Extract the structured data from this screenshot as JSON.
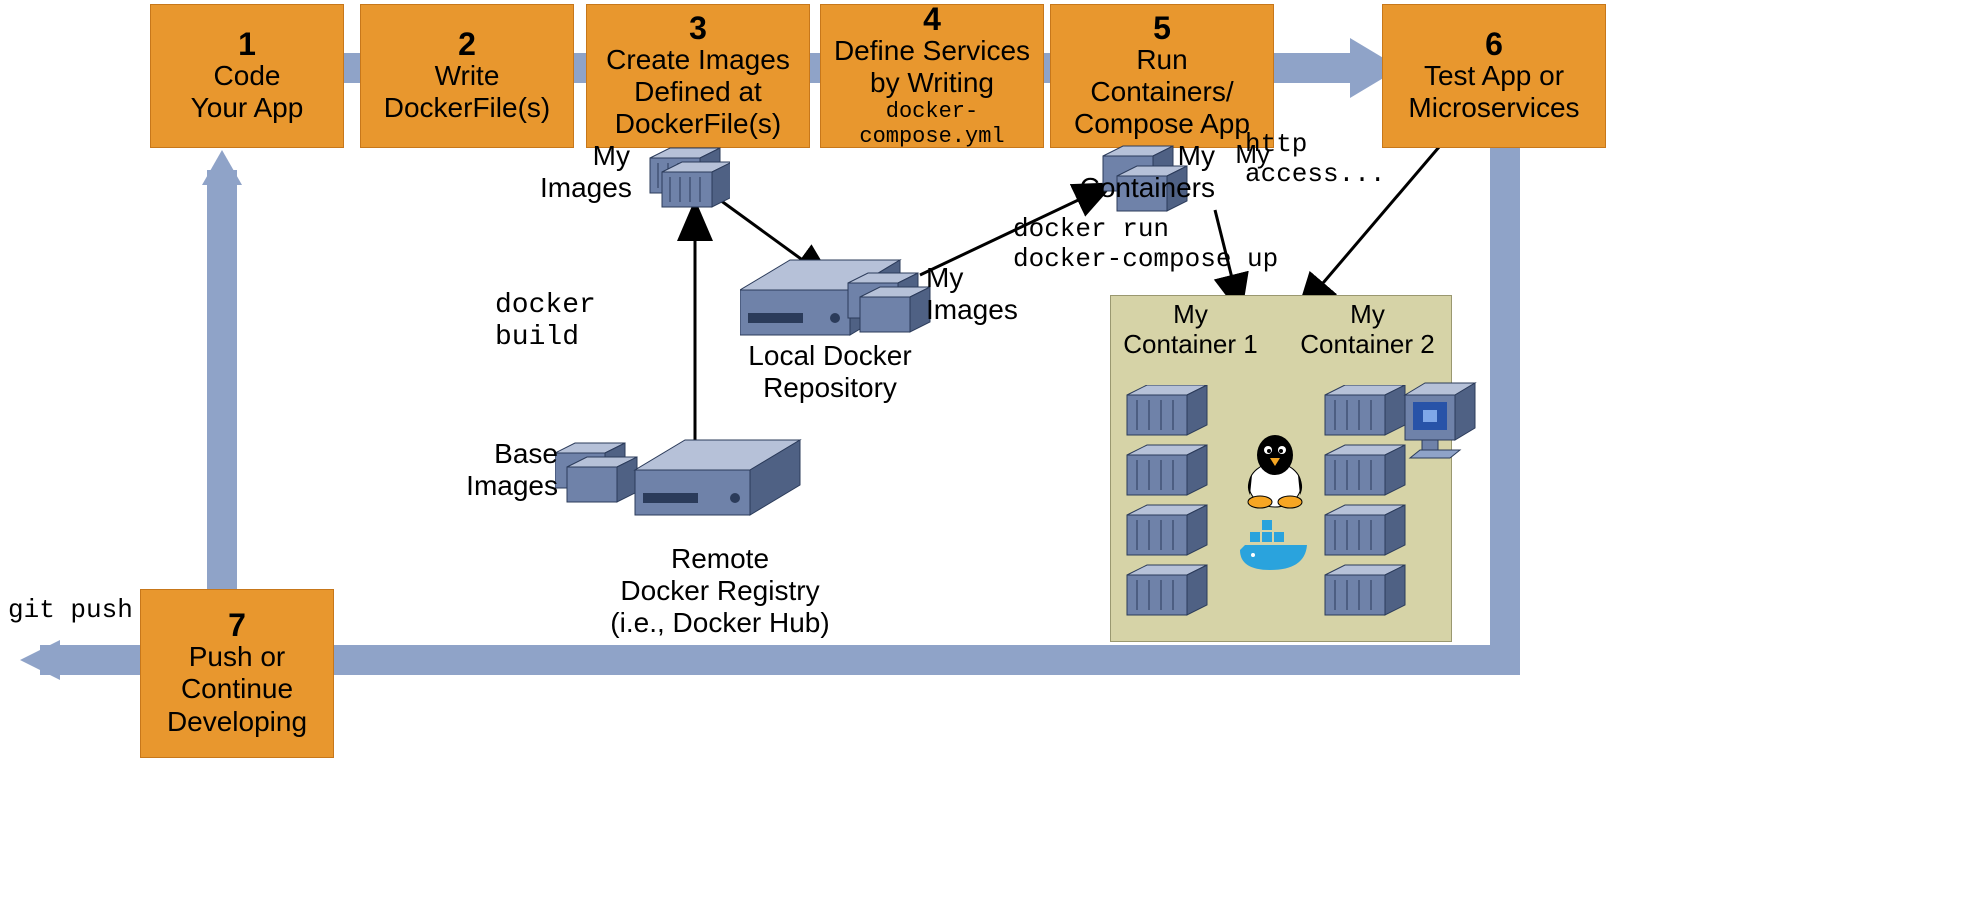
{
  "steps": [
    {
      "n": "1",
      "l1": "Code",
      "l2": "Your App"
    },
    {
      "n": "2",
      "l1": "Write",
      "l2": "DockerFile(s)"
    },
    {
      "n": "3",
      "l1": "Create Images",
      "l2": "Defined at",
      "l3": "DockerFile(s)"
    },
    {
      "n": "4",
      "l1": "Define Services",
      "l2": "by Writing",
      "l3mono": "docker-compose.yml"
    },
    {
      "n": "5",
      "l1": "Run",
      "l2": "Containers/",
      "l3": "Compose App"
    },
    {
      "n": "6",
      "l1": "Test App or",
      "l2": "Microservices"
    },
    {
      "n": "7",
      "l1": "Push or",
      "l2": "Continue",
      "l3": "Developing"
    }
  ],
  "labels": {
    "myImages1": "My\nImages",
    "myImages2": "My\nImages",
    "baseImages": "Base\nImages",
    "myContainers": "My\nContainers",
    "localRepo": "Local Docker\nRepository",
    "remoteRegistry": "Remote\nDocker Registry\n(i.e., Docker Hub)",
    "dockerBuild": "docker build",
    "dockerRun": "docker run\ndocker-compose up",
    "httpAccess": "http\naccess...",
    "gitPush": "git push",
    "myContainer1": "My\nContainer 1",
    "myContainer2": "My\nContainer 2"
  }
}
